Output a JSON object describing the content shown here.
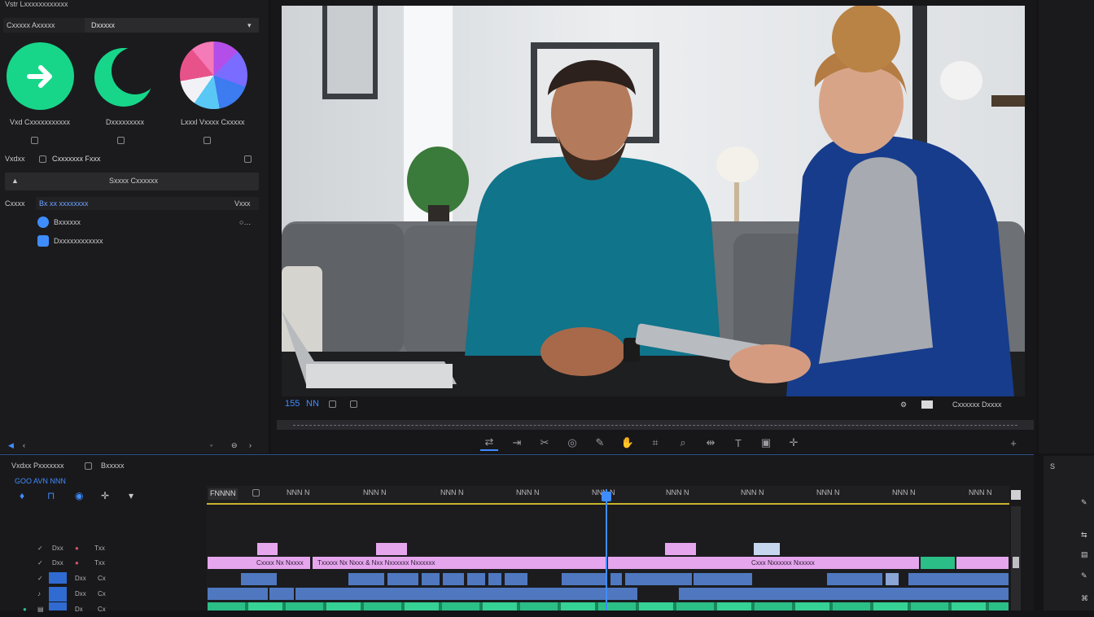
{
  "app": {
    "title": "Vstr Lxxxxxxxxxxxx"
  },
  "effects_panel": {
    "tab_left": "Cxxxxx Axxxxx",
    "tab_right": "Dxxxxx",
    "presets": [
      {
        "label": "Vxd Cxxxxxxxxxxx"
      },
      {
        "label": "Dxxxxxxxxx"
      },
      {
        "label": "Lxxxl Vxxxx Cxxxxx"
      }
    ],
    "section_label": "Vxdxx",
    "section_title": "Cxxxxxxx Fxxx",
    "search_button": "Sxxxx Cxxxxxx",
    "group_label": "Cxxxx",
    "group_title": "Bx xx xxxxxxxx",
    "group_right": "Vxxx",
    "items": [
      {
        "label": "Bxxxxxx"
      },
      {
        "label": "Dxxxxxxxxxxxx"
      }
    ]
  },
  "viewer": {
    "timecode_left": "155",
    "timecode_left2": "NN",
    "status_right": "Cxxxxxx  Dxxxx",
    "accent": "#3f8cff"
  },
  "timeline": {
    "panel_title": "Vxdxx Pxxxxxxx",
    "panel_title_right": "Bxxxxx",
    "sequence_name": "GOO AVN NNN",
    "time_label": "FNNNN",
    "timecodes": [
      "NNN N",
      "NNN N",
      "NNN N",
      "NNN N",
      "NNN N",
      "NNN N",
      "NNN N",
      "NNN N",
      "NNN N",
      "NNN N"
    ],
    "tracks": [
      {
        "a": "Dxx",
        "b": "Txx"
      },
      {
        "a": "Dxx",
        "b": "Txx"
      },
      {
        "a": "Dxx",
        "b": "Cx"
      },
      {
        "a": "Dxx",
        "b": "Cx"
      },
      {
        "a": "Dx",
        "b": "Cx"
      }
    ],
    "clips_row2": [
      "Cxxxx Nx Nxxxx",
      "Txxxxx Nx Nxxx & Nxx Nxxxxxx Nxxxxxx",
      "Cxxx Nxxxxxx Nxxxxx"
    ],
    "playhead_color": "#3f8cff",
    "pink": "#e6a6ee",
    "clip_blue": "#4f78c0",
    "clip_green": "#2bbf87"
  },
  "right_panel": {
    "label": "S"
  }
}
